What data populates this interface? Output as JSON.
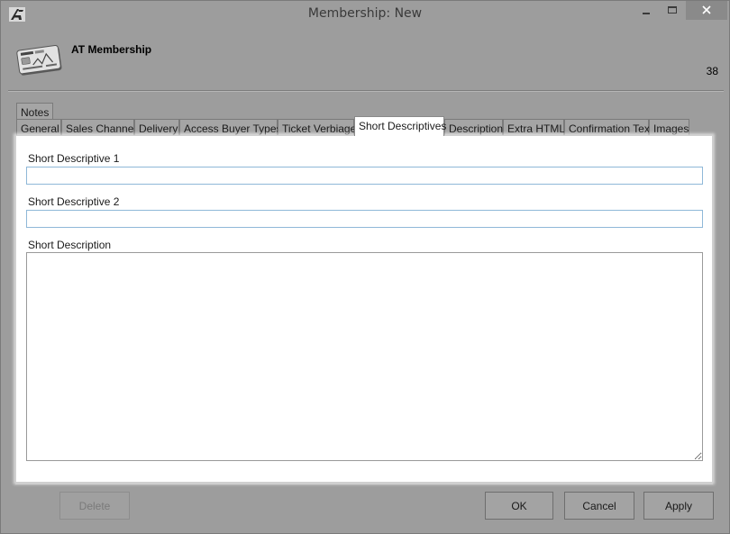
{
  "window": {
    "title": "Membership: New"
  },
  "header": {
    "heading": "AT Membership",
    "record_number": "38"
  },
  "tabs": {
    "row1": [
      {
        "label": "Notes"
      }
    ],
    "row2": [
      {
        "label": "General"
      },
      {
        "label": "Sales Channel"
      },
      {
        "label": "Delivery"
      },
      {
        "label": "Access Buyer Types"
      },
      {
        "label": "Ticket Verbiage"
      },
      {
        "label": "Short Descriptives",
        "active": true
      },
      {
        "label": "Description"
      },
      {
        "label": "Extra HTML"
      },
      {
        "label": "Confirmation Text"
      },
      {
        "label": "Images"
      }
    ]
  },
  "form": {
    "short_descriptive_1": {
      "label": "Short Descriptive 1",
      "value": ""
    },
    "short_descriptive_2": {
      "label": "Short Descriptive 2",
      "value": ""
    },
    "short_description": {
      "label": "Short Description",
      "value": ""
    }
  },
  "buttons": {
    "delete": "Delete",
    "ok": "OK",
    "cancel": "Cancel",
    "apply": "Apply"
  },
  "icons": {
    "app_logo": "app-logo-icon",
    "membership_card": "membership-card-icon",
    "minimize": "minimize-icon",
    "maximize": "maximize-icon",
    "close": "close-icon"
  }
}
